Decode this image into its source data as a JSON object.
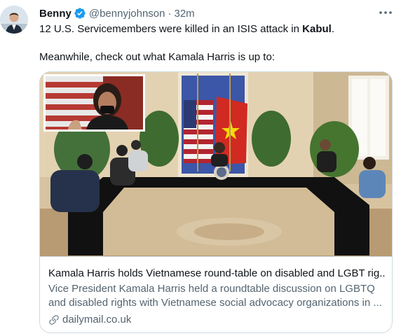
{
  "tweet": {
    "author_name": "Benny",
    "handle": "@bennyjohnson",
    "separator": "·",
    "time": "32m",
    "text_part1": "12 U.S. Servicemembers were killed in an ISIS attack in ",
    "text_bold": "Kabul",
    "text_part2": ".",
    "text_line2": "Meanwhile, check out what Kamala Harris is up to:"
  },
  "card": {
    "title": "Kamala Harris holds Vietnamese round-table on disabled and LGBT rig...",
    "description_line1": "Vice President Kamala Harris held a roundtable discussion on LGBTQ",
    "description_line2": "and disabled rights with Vietnamese social advocacy organizations in ...",
    "domain": "dailymail.co.uk"
  },
  "colors": {
    "text": "#0f1419",
    "secondary": "#536471",
    "verified": "#1d9bf0",
    "border": "#cfd9de"
  },
  "icons": [
    "avatar",
    "verified-badge-icon",
    "more-options-icon",
    "link-icon"
  ]
}
